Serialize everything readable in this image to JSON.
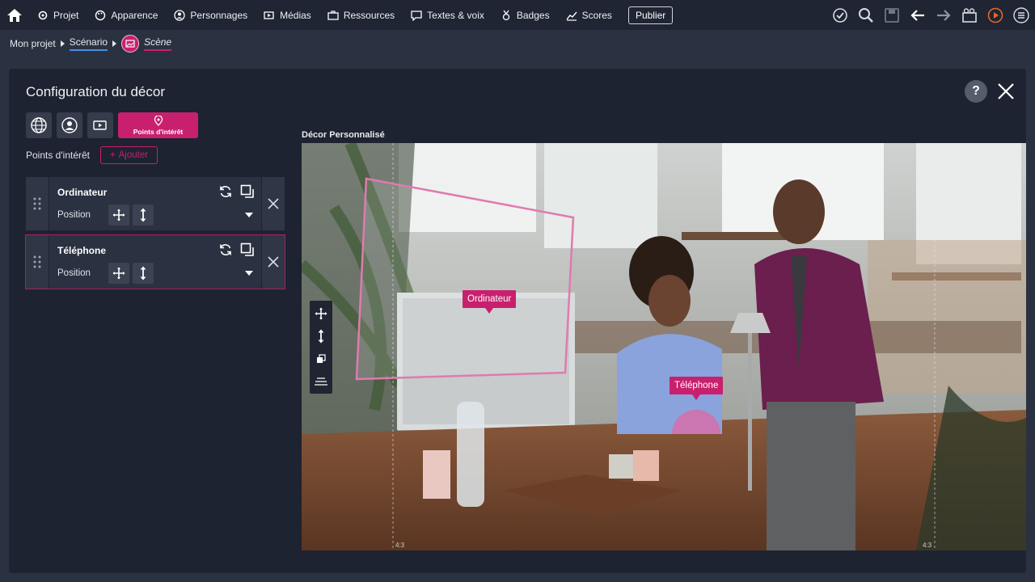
{
  "nav": {
    "items": [
      {
        "label": "Projet",
        "icon": "gear-icon"
      },
      {
        "label": "Apparence",
        "icon": "palette-icon"
      },
      {
        "label": "Personnages",
        "icon": "person-icon"
      },
      {
        "label": "Médias",
        "icon": "media-icon"
      },
      {
        "label": "Ressources",
        "icon": "briefcase-icon"
      },
      {
        "label": "Textes & voix",
        "icon": "speech-icon"
      },
      {
        "label": "Badges",
        "icon": "badge-icon"
      },
      {
        "label": "Scores",
        "icon": "chart-icon"
      }
    ],
    "publish_label": "Publier",
    "tools": [
      "check-icon",
      "search-icon",
      "save-icon",
      "undo-icon",
      "redo-icon",
      "camera-icon",
      "play-icon",
      "menu-icon"
    ]
  },
  "breadcrumb": {
    "project": "Mon projet",
    "scenario": "Scénario",
    "scene": "Scène"
  },
  "panel": {
    "title": "Configuration du décor",
    "help_label": "?",
    "tabs": [
      "globe-icon",
      "character-icon",
      "media-icon"
    ],
    "active_tab_label": "Points d'intérêt",
    "poi_section_label": "Points d'intérêt",
    "add_label": "Ajouter",
    "points": [
      {
        "name": "Ordinateur",
        "position_label": "Position"
      },
      {
        "name": "Téléphone",
        "position_label": "Position"
      }
    ]
  },
  "viewport": {
    "title": "Décor Personnalisé",
    "tags": [
      "Ordinateur",
      "Téléphone"
    ],
    "ratio_left": "4:3",
    "ratio_right": "4:3"
  },
  "colors": {
    "accent": "#c8206e",
    "background": "#2a3140",
    "panel": "#1d2331",
    "topbar": "#1f2532"
  }
}
